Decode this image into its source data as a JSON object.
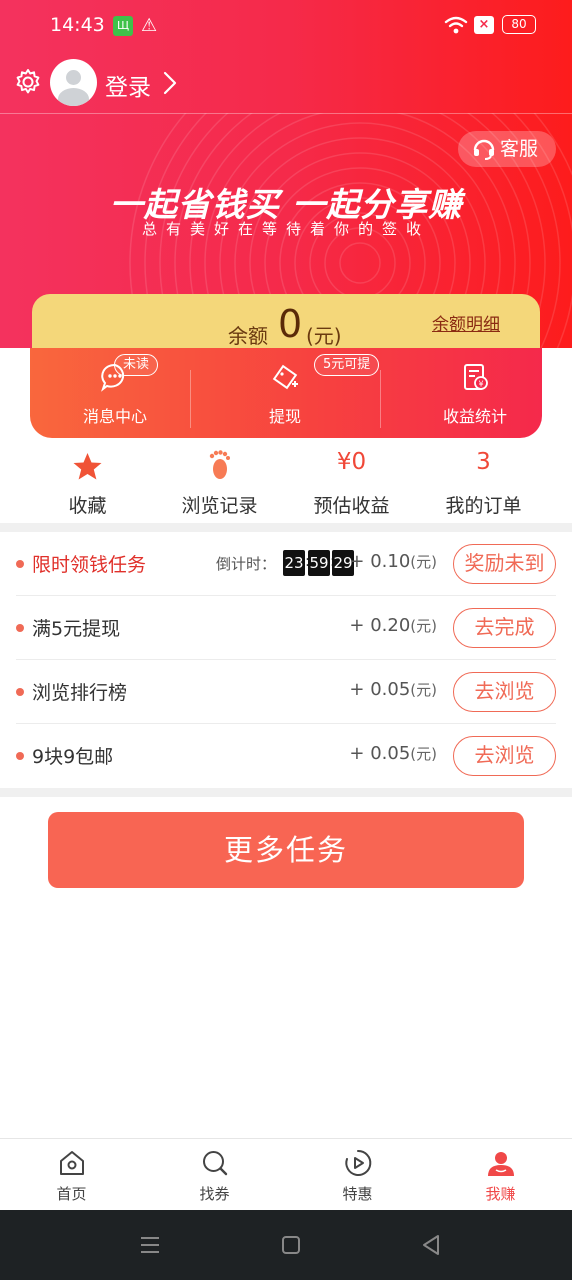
{
  "status_bar": {
    "time": "14:43",
    "sim_label": "Щ",
    "warning_symbol": "⚠",
    "battery": "80"
  },
  "header": {
    "login_label": "登录",
    "service_label": "客服",
    "slogan": "一起省钱买  一起分享赚",
    "subslogan": "总有美好在等待着你的签收",
    "accent_color": "#f52a4a"
  },
  "balance": {
    "label": "余额",
    "amount": "0",
    "unit": "(元)",
    "detail_link": "余额明细"
  },
  "actions": [
    {
      "label": "消息中心",
      "tag": "未读",
      "icon": "message-icon"
    },
    {
      "label": "提现",
      "tag": "5元可提",
      "icon": "withdraw-icon"
    },
    {
      "label": "收益统计",
      "tag": "",
      "icon": "earnings-chart-icon"
    }
  ],
  "stats": [
    {
      "label": "收藏",
      "value": "",
      "icon": "star-icon"
    },
    {
      "label": "浏览记录",
      "value": "",
      "icon": "footprint-icon"
    },
    {
      "label": "预估收益",
      "value": "¥0"
    },
    {
      "label": "我的订单",
      "value": "3"
    }
  ],
  "tasks": {
    "countdown_label": "倒计时：",
    "countdown": [
      "23",
      "59",
      "29"
    ],
    "unit": "(元)",
    "items": [
      {
        "name": "限时领钱任务",
        "reward": "+ 0.10",
        "button": "奖励未到"
      },
      {
        "name": "满5元提现",
        "reward": "+ 0.20",
        "button": "去完成"
      },
      {
        "name": "浏览排行榜",
        "reward": "+ 0.05",
        "button": "去浏览"
      },
      {
        "name": "9块9包邮",
        "reward": "+ 0.05",
        "button": "去浏览"
      }
    ]
  },
  "more_button": "更多任务",
  "tabbar": [
    {
      "label": "首页",
      "icon": "home-icon",
      "active": false
    },
    {
      "label": "找券",
      "icon": "search-icon",
      "active": false
    },
    {
      "label": "特惠",
      "icon": "play-icon",
      "active": false
    },
    {
      "label": "我赚",
      "icon": "user-icon",
      "active": true
    }
  ],
  "active_color": "#f04848"
}
